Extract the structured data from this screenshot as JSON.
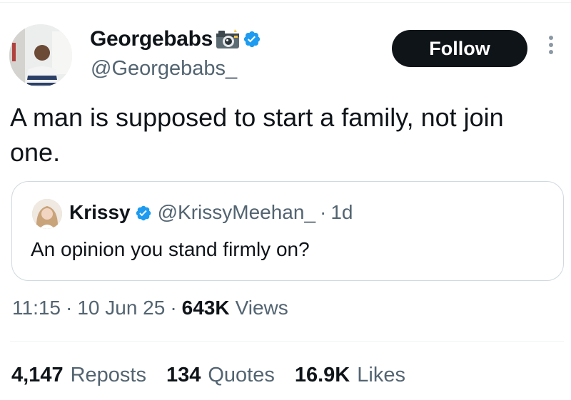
{
  "author": {
    "display_name": "Georgebabs",
    "handle": "@Georgebabs_",
    "name_emoji_icon": "camera-with-flash-icon",
    "verified": true,
    "verified_color": "#1d9bf0"
  },
  "follow_button": {
    "label": "Follow",
    "background": "#0f1419"
  },
  "more_menu_icon": "vertical-ellipsis-icon",
  "tweet": {
    "text": "A man is supposed to start a family, not join one."
  },
  "quoted_tweet": {
    "display_name": "Krissy",
    "handle": "@KrissyMeehan_",
    "separator": "·",
    "time_ago": "1d",
    "verified": true,
    "text": "An opinion you stand firmly on?"
  },
  "meta": {
    "time": "11:15",
    "sep1": "·",
    "date": "10 Jun 25",
    "sep2": "·",
    "views_count": "643K",
    "views_label": "Views"
  },
  "stats": {
    "reposts_count": "4,147",
    "reposts_label": "Reposts",
    "quotes_count": "134",
    "quotes_label": "Quotes",
    "likes_count": "16.9K",
    "likes_label": "Likes"
  },
  "colors": {
    "text_primary": "#0f1419",
    "text_secondary": "#536471",
    "border": "#cfd9de"
  }
}
